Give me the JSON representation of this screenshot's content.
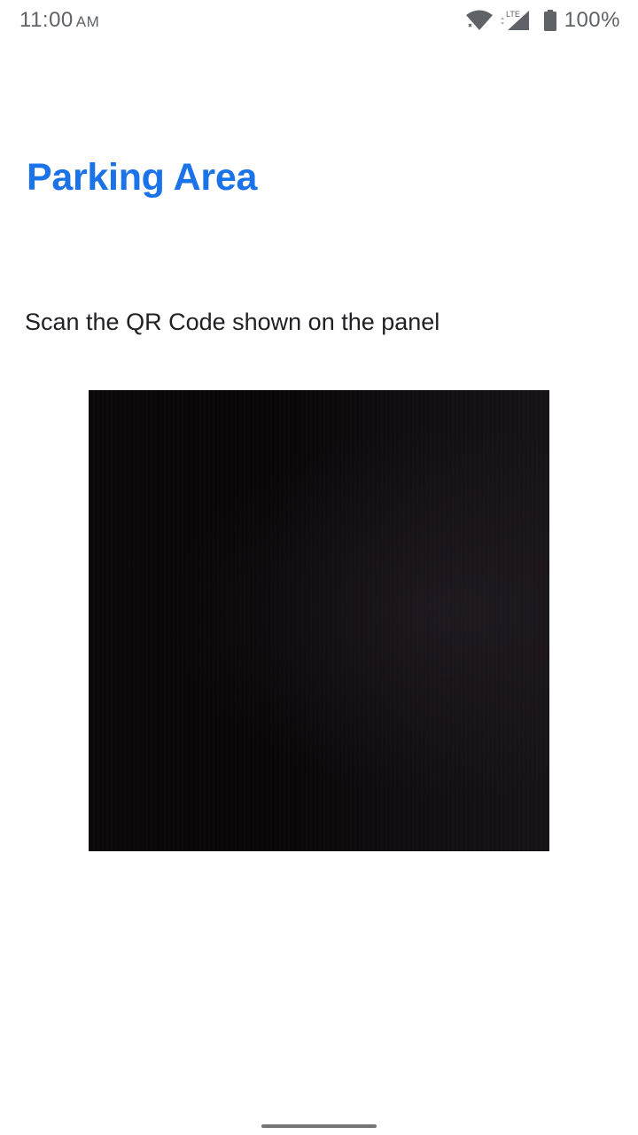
{
  "status_bar": {
    "time": "11:00",
    "ampm": "AM",
    "network_label": "LTE",
    "battery": "100%",
    "icons": [
      "wifi-icon",
      "lte-signal-icon",
      "battery-icon"
    ]
  },
  "page": {
    "title": "Parking Area",
    "instruction": "Scan the QR Code shown on the panel"
  },
  "colors": {
    "title": "#1a73e8",
    "text": "#202124",
    "status": "#5f6368",
    "preview_bg": "#0b0809"
  }
}
